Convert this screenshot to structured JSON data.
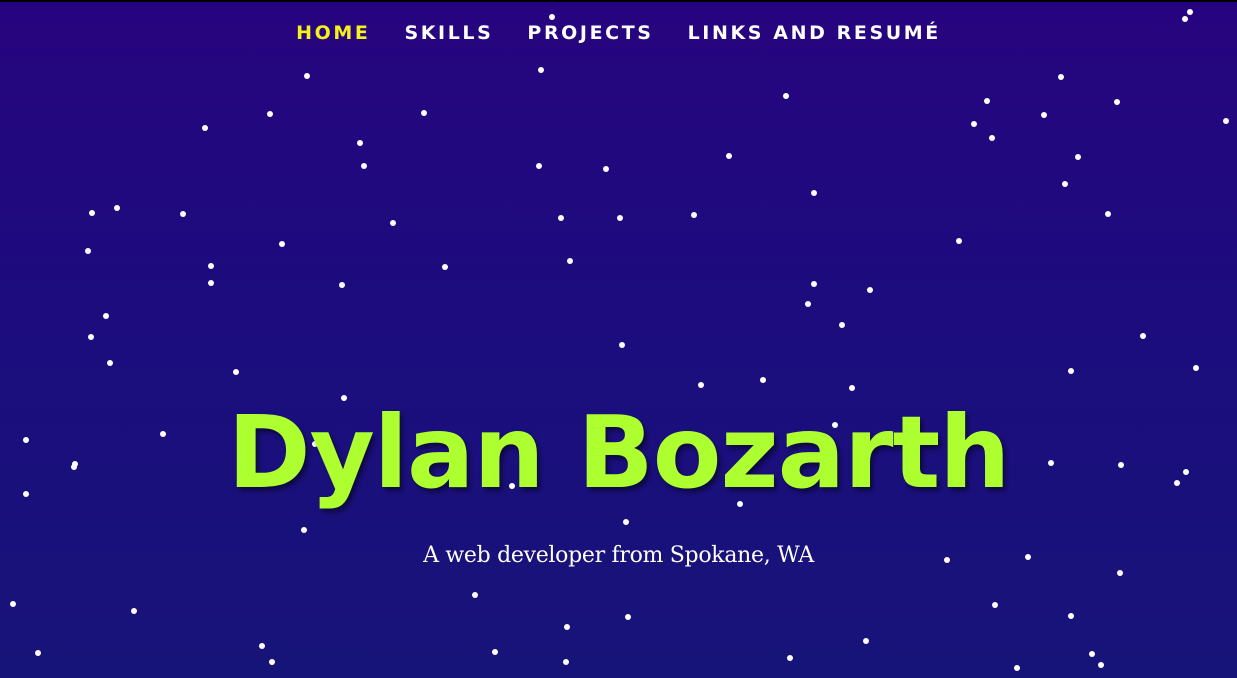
{
  "nav": {
    "items": [
      {
        "label": "HOME",
        "active": true
      },
      {
        "label": "SKILLS",
        "active": false
      },
      {
        "label": "PROJECTS",
        "active": false
      },
      {
        "label": "LINKS AND RESUMÉ",
        "active": false
      }
    ]
  },
  "hero": {
    "title": "Dylan Bozarth",
    "subtitle": "A web developer from Spokane, WA"
  },
  "colors": {
    "background_top": "#27047f",
    "background_bottom": "#171479",
    "accent_active_nav": "#f5f11c",
    "title_green": "#adff2f",
    "star": "#ffffff"
  }
}
